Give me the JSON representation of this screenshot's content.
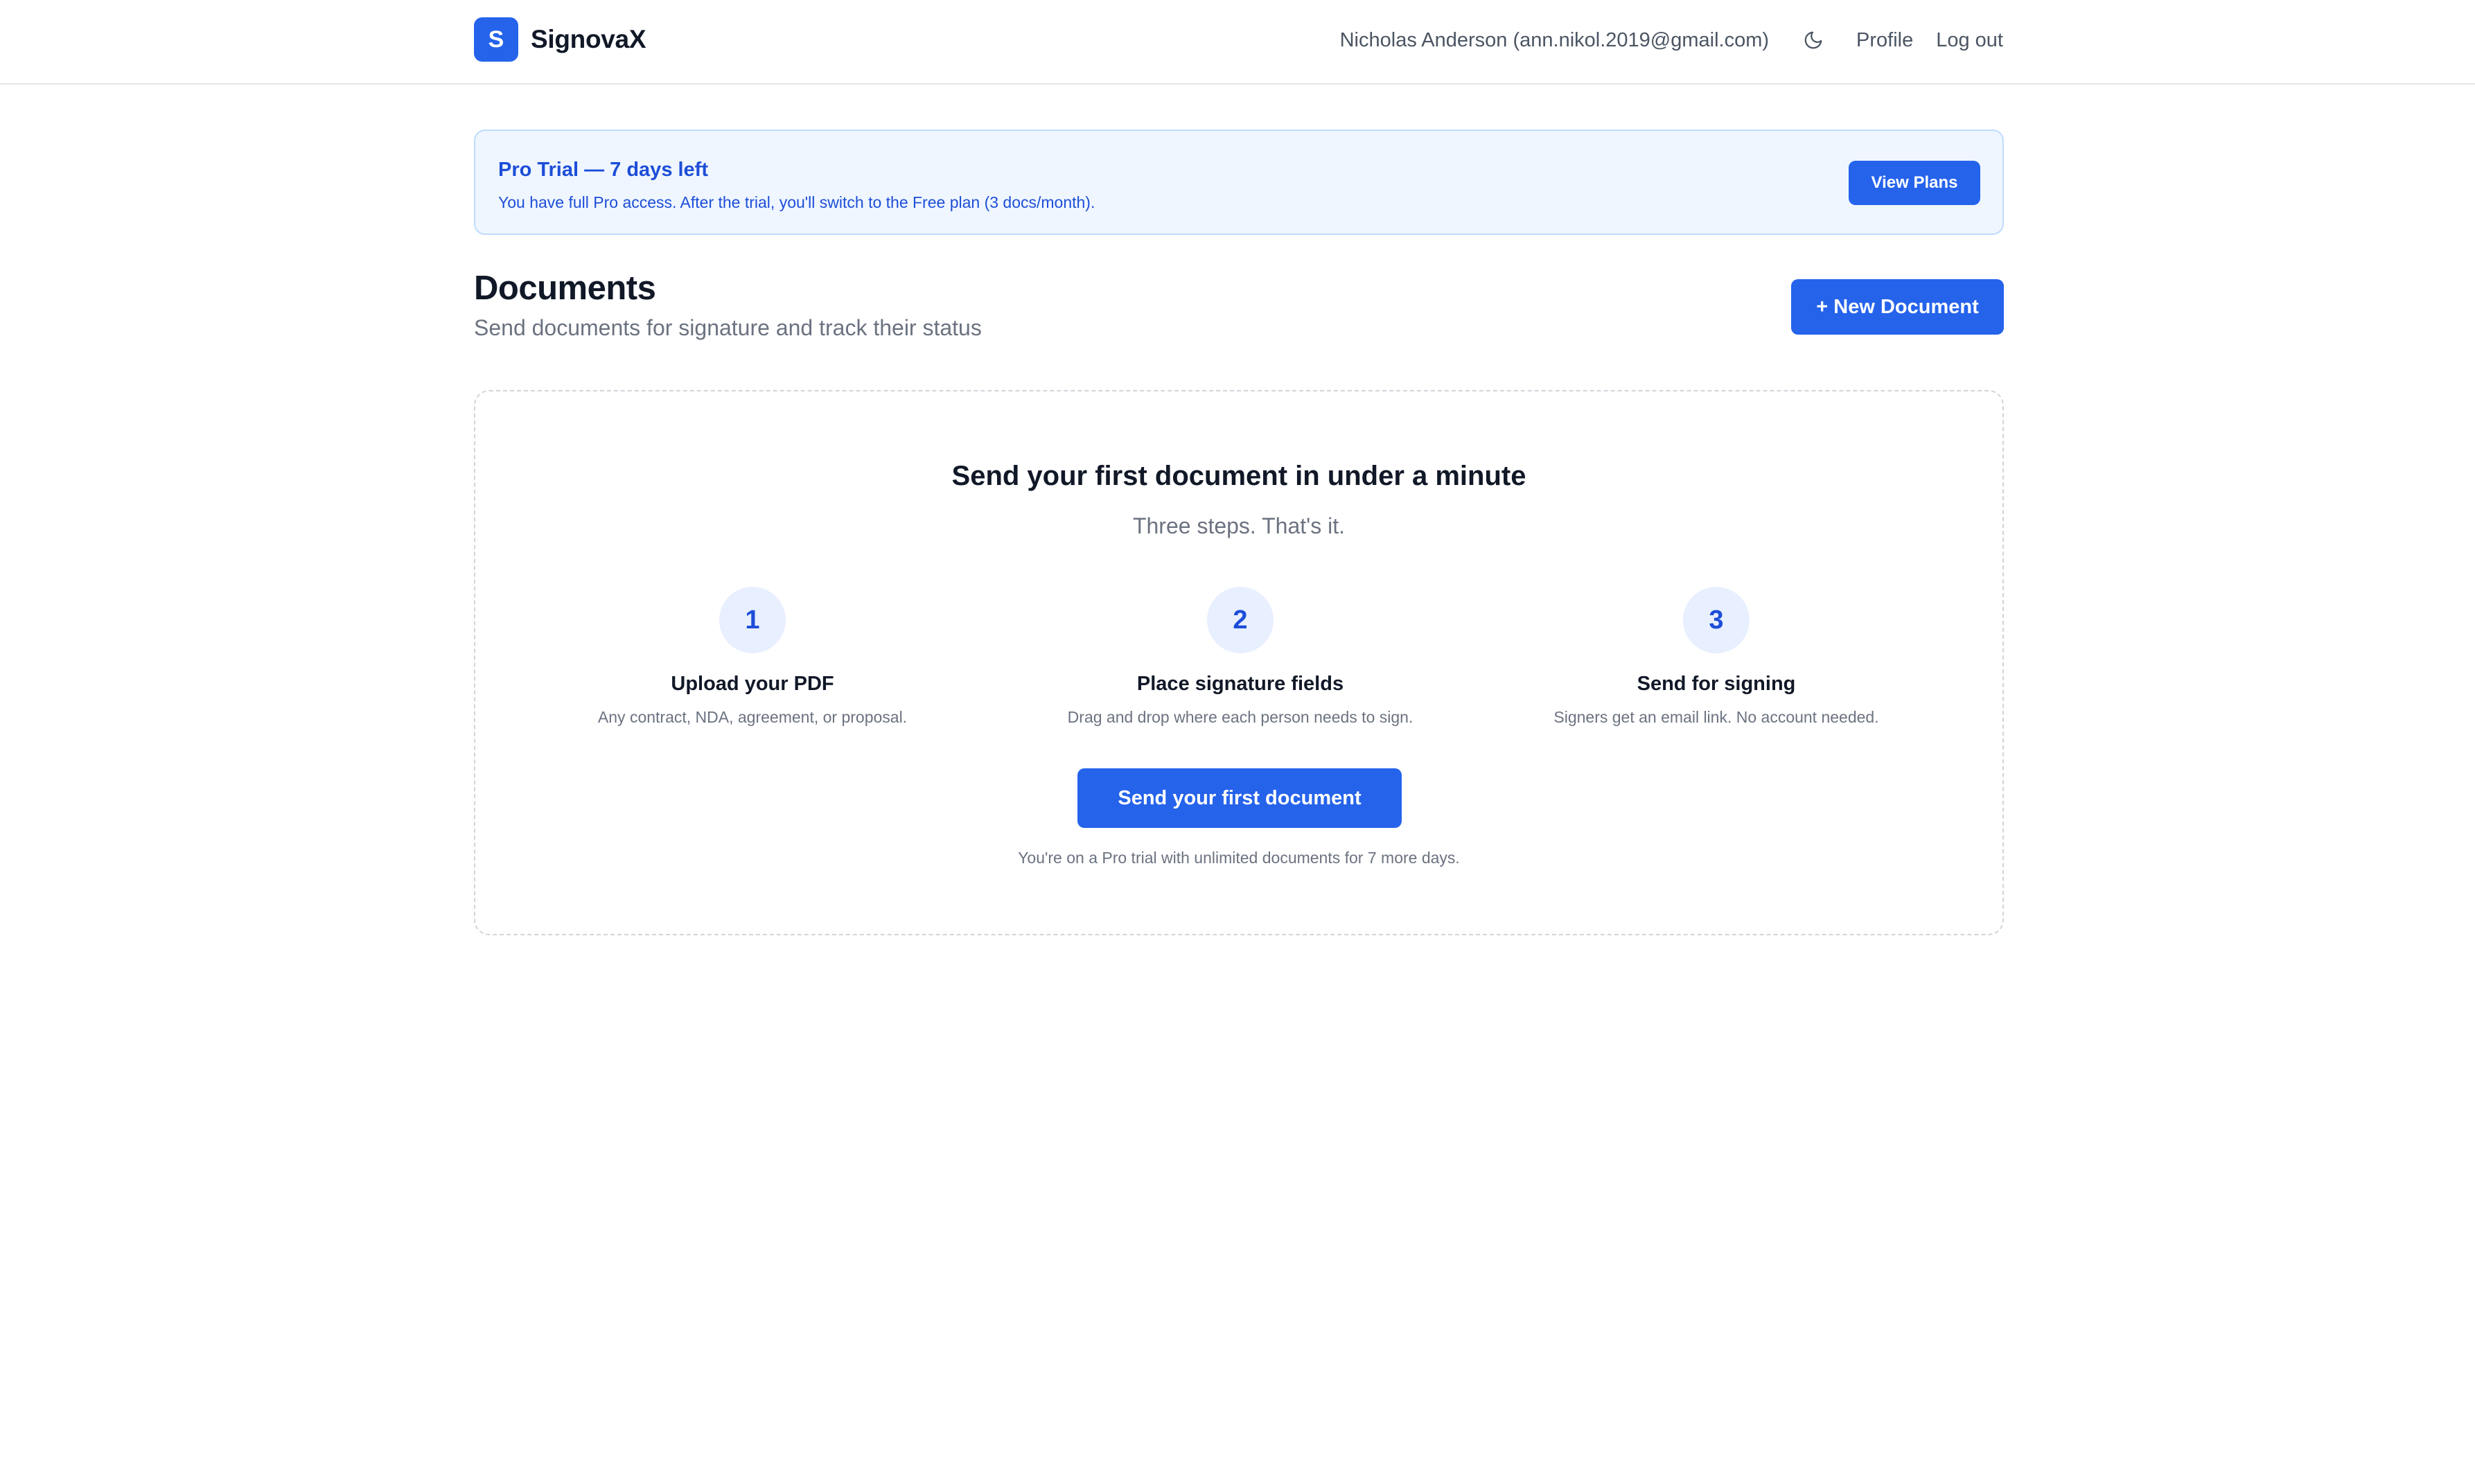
{
  "header": {
    "logo_letter": "S",
    "app_name": "SignovaX",
    "user_label": "Nicholas Anderson (ann.nikol.2019@gmail.com)",
    "theme_toggle_icon": "moon-icon",
    "profile_label": "Profile",
    "logout_label": "Log out"
  },
  "trial": {
    "title": "Pro Trial — 7 days left",
    "description": "You have full Pro access. After the trial, you'll switch to the Free plan (3 docs/month).",
    "cta_label": "View Plans"
  },
  "page": {
    "title": "Documents",
    "subtitle": "Send documents for signature and track their status",
    "new_document_label": "+ New Document"
  },
  "onboarding": {
    "heading": "Send your first document in under a minute",
    "subheading": "Three steps. That's it.",
    "steps": [
      {
        "number": "1",
        "title": "Upload your PDF",
        "description": "Any contract, NDA, agreement, or proposal."
      },
      {
        "number": "2",
        "title": "Place signature fields",
        "description": "Drag and drop where each person needs to sign."
      },
      {
        "number": "3",
        "title": "Send for signing",
        "description": "Signers get an email link. No account needed."
      }
    ],
    "cta_label": "Send your first document",
    "note": "You're on a Pro trial with unlimited documents for 7 more days."
  },
  "colors": {
    "accent": "#2563eb",
    "accent_dark": "#1d4ed8",
    "banner_bg": "#eff6ff",
    "banner_border": "#bfdbfe",
    "muted_text": "#6b7280"
  }
}
